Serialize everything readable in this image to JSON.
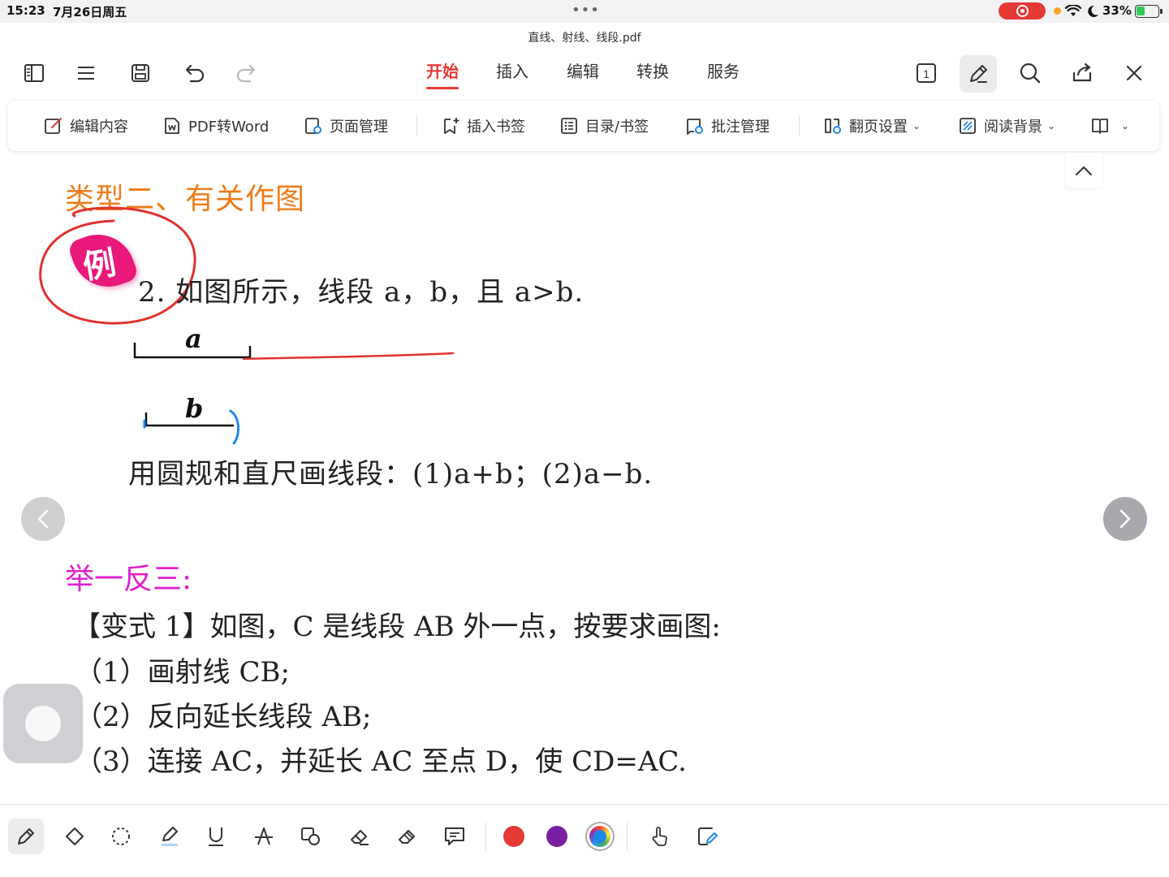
{
  "status": {
    "time": "15:23",
    "date": "7月26日周五",
    "battery": "33%"
  },
  "document": {
    "filename": "直线、射线、线段.pdf"
  },
  "menu": {
    "tabs": [
      "开始",
      "插入",
      "编辑",
      "转换",
      "服务"
    ],
    "active": "开始"
  },
  "ribbon": {
    "edit_content": "编辑内容",
    "pdf_to_word": "PDF转Word",
    "page_manage": "页面管理",
    "insert_bookmark": "插入书签",
    "toc_bookmark": "目录/书签",
    "annotation_manage": "批注管理",
    "page_turn_settings": "翻页设置",
    "reading_background": "阅读背景"
  },
  "content": {
    "heading_type": "类型二、有关作图",
    "example_glyph": "例",
    "question": "2.  如图所示，线段 a，b，且 a>b.",
    "label_a": "a",
    "label_b": "b",
    "instruction": "用圆规和直尺画线段：(1)a+b；(2)a−b.",
    "practice_heading": "举一反三:",
    "variant_intro": "【变式 1】如图，C 是线段 AB 外一点，按要求画图:",
    "step1": "（1）画射线 CB;",
    "step2": "（2）反向延长线段 AB;",
    "step3": "（3）连接 AC，并延长 AC 至点 D，使 CD=AC."
  },
  "annotation_colors": {
    "red": "#e53935",
    "purple": "#7b1fa2",
    "multi": "#1e88e5"
  },
  "ink": {
    "red_stroke": "#e0322e",
    "blue_stroke": "#1e88e5"
  }
}
